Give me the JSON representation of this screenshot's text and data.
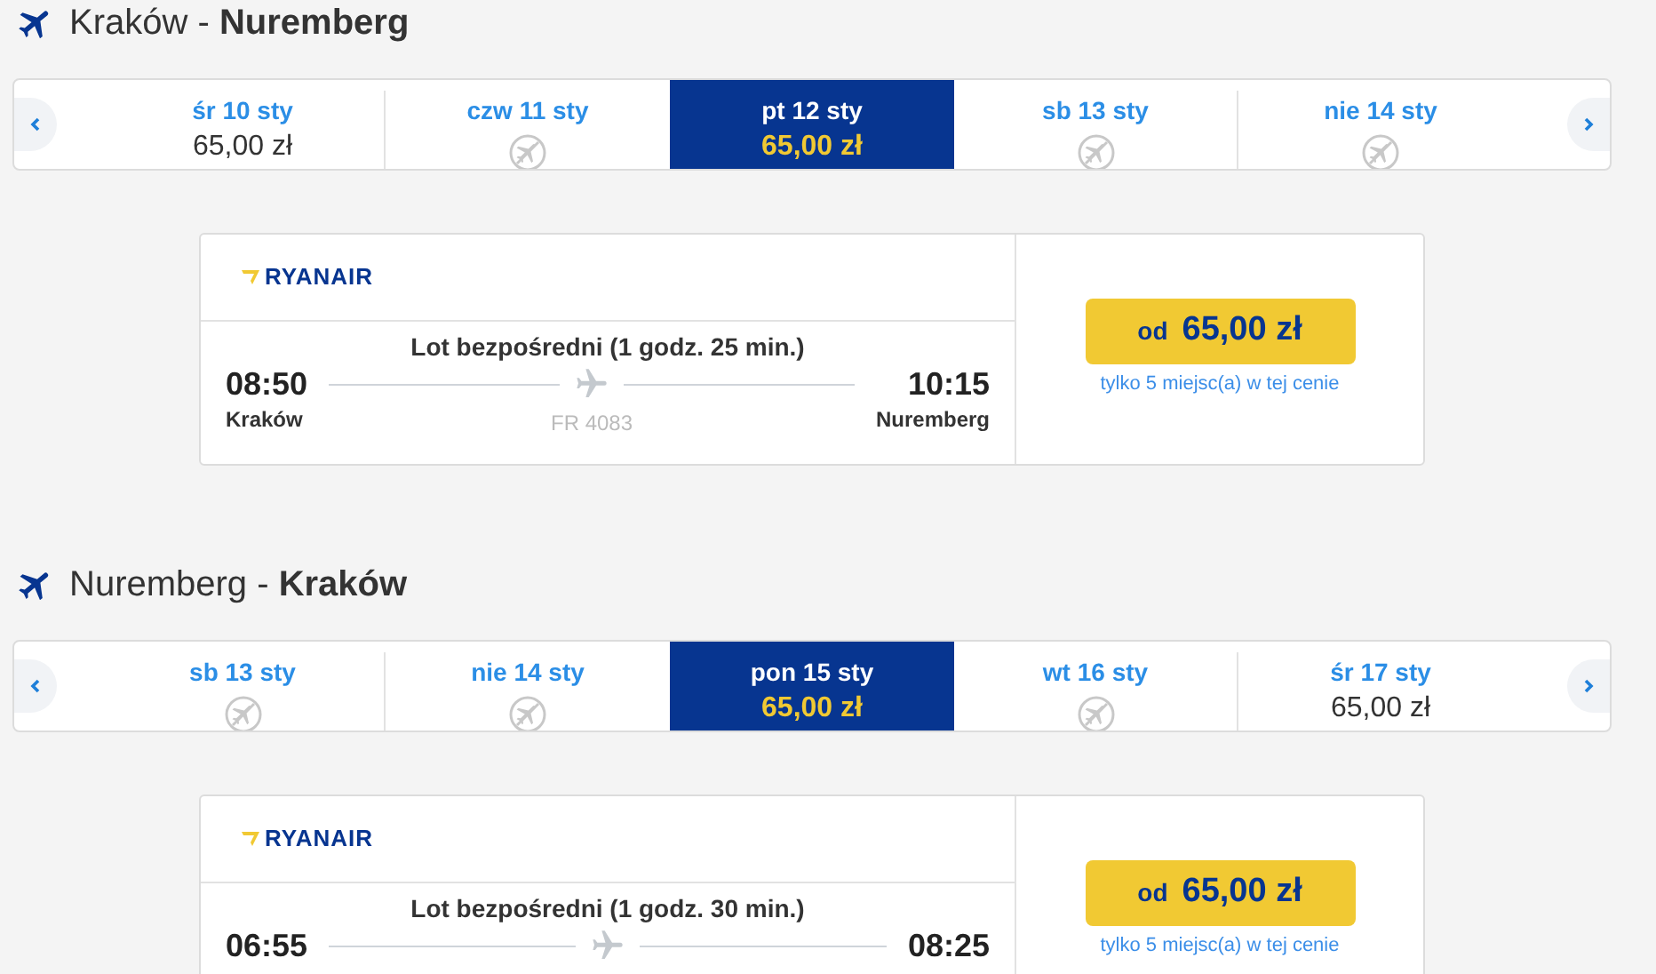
{
  "sections": [
    {
      "from": "Kraków",
      "separator": "-",
      "to": "Nuremberg",
      "days": [
        {
          "label": "śr 10 sty",
          "price": "65,00 zł",
          "selected": false
        },
        {
          "label": "czw 11 sty",
          "selected": false
        },
        {
          "label": "pt 12 sty",
          "price": "65,00 zł",
          "selected": true
        },
        {
          "label": "sb 13 sty",
          "selected": false
        },
        {
          "label": "nie 14 sty",
          "selected": false
        }
      ],
      "flight": {
        "airline": "RYANAIR",
        "summary": "Lot bezpośredni",
        "duration": "(1 godz. 25 min.)",
        "depart_time": "08:50",
        "depart_city": "Kraków",
        "arrive_time": "10:15",
        "arrive_city": "Nuremberg",
        "flight_number": "FR 4083",
        "price_prefix": "od",
        "price": "65,00 zł",
        "seats_note": "tylko 5 miejsc(a) w tej cenie"
      }
    },
    {
      "from": "Nuremberg",
      "separator": "-",
      "to": "Kraków",
      "days": [
        {
          "label": "sb 13 sty",
          "selected": false
        },
        {
          "label": "nie 14 sty",
          "selected": false
        },
        {
          "label": "pon 15 sty",
          "price": "65,00 zł",
          "selected": true
        },
        {
          "label": "wt 16 sty",
          "selected": false
        },
        {
          "label": "śr 17 sty",
          "price": "65,00 zł",
          "selected": false
        }
      ],
      "flight": {
        "airline": "RYANAIR",
        "summary": "Lot bezpośredni",
        "duration": "(1 godz. 30 min.)",
        "depart_time": "06:55",
        "arrive_time": "08:25",
        "price_prefix": "od",
        "price": "65,00 zł",
        "seats_note": "tylko 5 miejsc(a) w tej cenie"
      }
    }
  ]
}
